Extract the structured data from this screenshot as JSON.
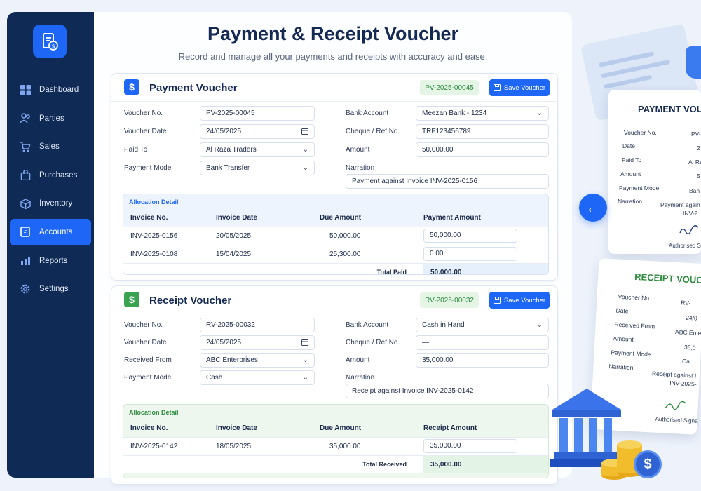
{
  "sidebar": {
    "items": [
      {
        "label": "Dashboard",
        "icon": "grid-icon"
      },
      {
        "label": "Parties",
        "icon": "users-icon"
      },
      {
        "label": "Sales",
        "icon": "cart-icon"
      },
      {
        "label": "Purchases",
        "icon": "bag-icon"
      },
      {
        "label": "Inventory",
        "icon": "box-icon"
      },
      {
        "label": "Accounts",
        "icon": "ledger-icon",
        "active": true
      },
      {
        "label": "Reports",
        "icon": "bar-chart-icon"
      },
      {
        "label": "Settings",
        "icon": "gear-icon"
      }
    ]
  },
  "header": {
    "title": "Payment & Receipt Voucher",
    "subtitle": "Record and manage all your payments and receipts with accuracy and ease."
  },
  "payment": {
    "title": "Payment Voucher",
    "icon_glyph": "$",
    "badge": "PV-2025-00045",
    "save_label": "Save Voucher",
    "voucher_no_label": "Voucher No.",
    "voucher_no": "PV-2025-00045",
    "voucher_date_label": "Voucher Date",
    "voucher_date": "24/05/2025",
    "party_label": "Paid To",
    "party": "Al Raza Traders",
    "mode_label": "Payment Mode",
    "mode": "Bank Transfer",
    "bank_label": "Bank Account",
    "bank": "Meezan Bank - 1234",
    "cheque_label": "Cheque / Ref No.",
    "cheque": "TRF123456789",
    "amount_label": "Amount",
    "amount": "50,000.00",
    "narration_label": "Narration",
    "narration": "Payment against Invoice INV-2025-0156",
    "alloc_title": "Allocation Detail",
    "columns": [
      "Invoice No.",
      "Invoice Date",
      "Due Amount",
      "Payment Amount"
    ],
    "rows": [
      {
        "invoice": "INV-2025-0156",
        "date": "20/05/2025",
        "due": "50,000.00",
        "paid": "50,000.00"
      },
      {
        "invoice": "INV-2025-0108",
        "date": "15/04/2025",
        "due": "25,300.00",
        "paid": "0.00"
      }
    ],
    "total_label": "Total Paid",
    "total": "50,000.00"
  },
  "receipt": {
    "title": "Receipt Voucher",
    "icon_glyph": "$",
    "badge": "RV-2025-00032",
    "save_label": "Save Voucher",
    "voucher_no_label": "Voucher No.",
    "voucher_no": "RV-2025-00032",
    "voucher_date_label": "Voucher Date",
    "voucher_date": "24/05/2025",
    "party_label": "Received From",
    "party": "ABC Enterprises",
    "mode_label": "Payment Mode",
    "mode": "Cash",
    "bank_label": "Bank Account",
    "bank": "Cash in Hand",
    "cheque_label": "Cheque / Ref No.",
    "cheque": "—",
    "amount_label": "Amount",
    "amount": "35,000.00",
    "narration_label": "Narration",
    "narration": "Receipt against Invoice INV-2025-0142",
    "alloc_title": "Allocation Detail",
    "columns": [
      "Invoice No.",
      "Invoice Date",
      "Due Amount",
      "Receipt Amount"
    ],
    "rows": [
      {
        "invoice": "INV-2025-0142",
        "date": "18/05/2025",
        "due": "35,000.00",
        "paid": "35,000.00"
      }
    ],
    "total_label": "Total Received",
    "total": "35,000.00"
  },
  "preview_payment": {
    "title": "PAYMENT VOU",
    "lines": [
      {
        "label": "Voucher No.",
        "value": "PV-"
      },
      {
        "label": "Date",
        "value": "2"
      },
      {
        "label": "Paid To",
        "value": "Al Ra"
      },
      {
        "label": "Amount",
        "value": "5"
      },
      {
        "label": "Payment Mode",
        "value": "Ban"
      },
      {
        "label": "Narration",
        "value": "Payment again"
      }
    ],
    "narration_cont": "INV-2",
    "signature": "Authorised S"
  },
  "preview_receipt": {
    "title": "RECEIPT VOUCHE",
    "lines": [
      {
        "label": "Voucher No.",
        "value": "RV-"
      },
      {
        "label": "Date",
        "value": "24/0"
      },
      {
        "label": "Received From",
        "value": "ABC Ente"
      },
      {
        "label": "Amount",
        "value": "35,0"
      },
      {
        "label": "Payment Mode",
        "value": "Ca"
      },
      {
        "label": "Narration",
        "value": "Receipt against I"
      }
    ],
    "narration_cont": "INV-2025-",
    "signature": "Authorised Signa"
  },
  "bank_icon_glyph": "$",
  "colors": {
    "sidebar": "#0f2a55",
    "accent": "#1e66f5",
    "payment_badge_bg": "#e4f5e6",
    "receipt_icon": "#3aa352",
    "receipt_tint": "#edf7ee",
    "payment_tint": "#eef4fd"
  }
}
